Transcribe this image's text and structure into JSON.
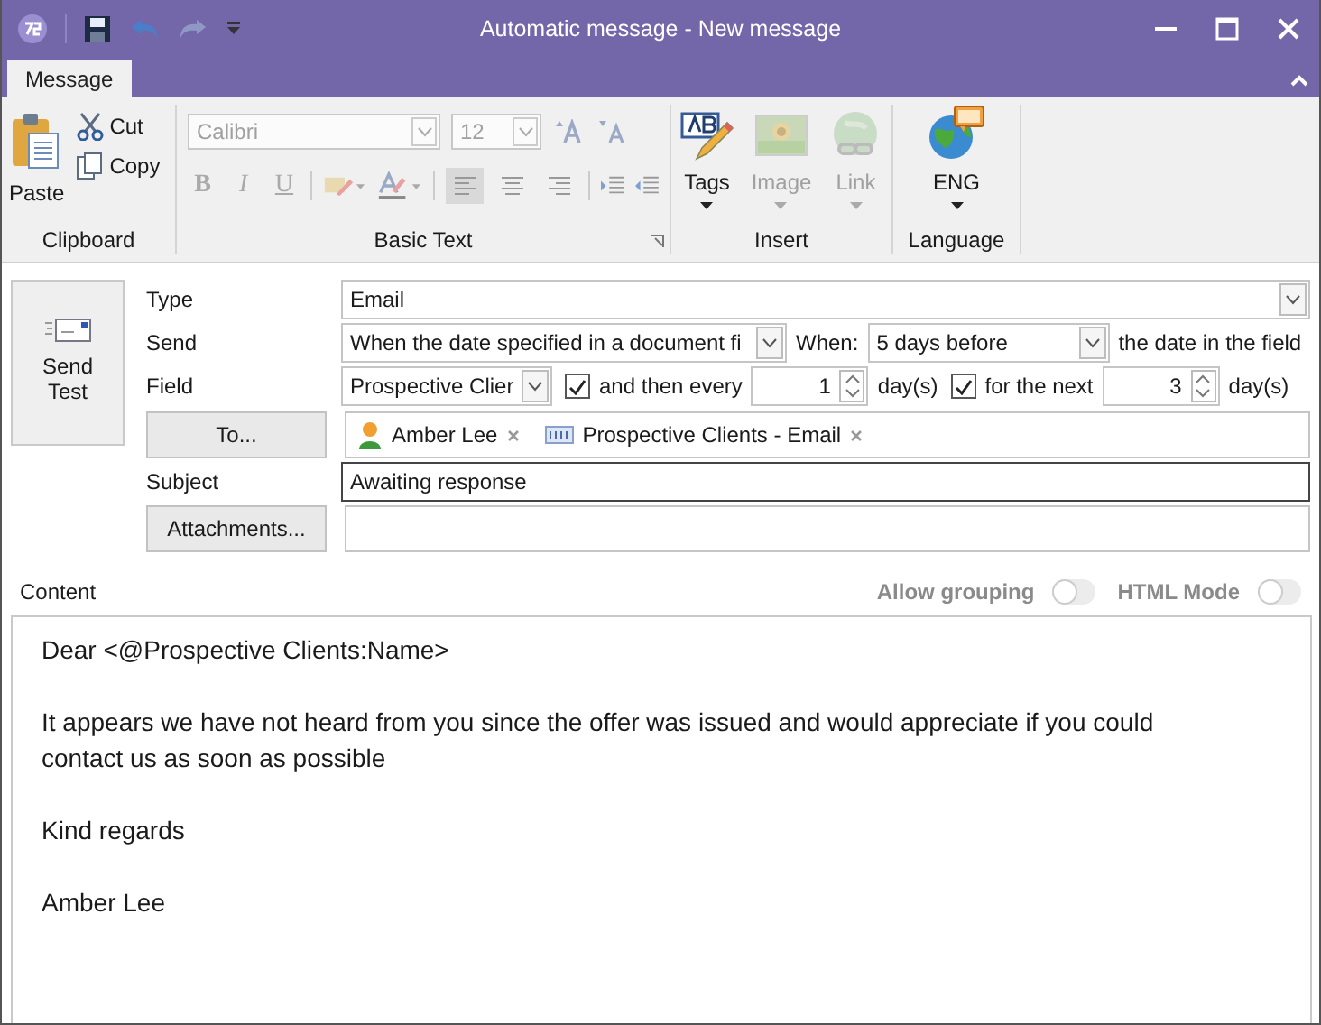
{
  "window": {
    "title": "Automatic message - New message"
  },
  "ribbon_tabs": [
    {
      "label": "Message",
      "selected": true
    }
  ],
  "clipboard": {
    "label": "Clipboard",
    "paste": "Paste",
    "cut": "Cut",
    "copy": "Copy"
  },
  "basic_text": {
    "label": "Basic Text",
    "font": "Calibri",
    "size": "12",
    "disabled": true,
    "format_buttons": [
      "B",
      "I",
      "U"
    ],
    "alignment": [
      {
        "selected": true
      },
      {
        "selected": false
      },
      {
        "selected": false
      }
    ]
  },
  "insert": {
    "label": "Insert",
    "items": [
      {
        "label": "Tags",
        "disabled": false,
        "kind": "tags"
      },
      {
        "label": "Image",
        "disabled": true,
        "kind": "image"
      },
      {
        "label": "Link",
        "disabled": true,
        "kind": "link"
      }
    ]
  },
  "language": {
    "label": "Language",
    "value": "ENG"
  },
  "send_test": "Send Test",
  "type": {
    "label": "Type",
    "value": "Email"
  },
  "send": {
    "label": "Send",
    "value": "When the date specified in a document fi",
    "when_label": "When:",
    "when_value": "5 days before",
    "suffix": "the date in the field"
  },
  "field": {
    "label": "Field",
    "value": "Prospective Clier",
    "then_every": {
      "label": "and then every",
      "checked": true
    },
    "every_value": "1",
    "every_unit": "day(s)",
    "for_next": {
      "label": "for the next",
      "checked": true
    },
    "next_value": "3",
    "next_unit": "day(s)"
  },
  "to": {
    "button": "To...",
    "recipients": [
      {
        "kind": "person",
        "name": "Amber Lee"
      },
      {
        "kind": "field",
        "name": "Prospective Clients - Email"
      }
    ]
  },
  "subject": {
    "label": "Subject",
    "value": "Awaiting response"
  },
  "attachments": {
    "button": "Attachments..."
  },
  "content": {
    "label": "Content",
    "toggles": [
      {
        "label": "Allow grouping",
        "on": false
      },
      {
        "label": "HTML Mode",
        "on": false
      }
    ],
    "paragraphs": [
      "Dear <@Prospective Clients:Name>",
      "It appears we have not heard from you since the offer was issued and would appreciate if you could contact us as soon as possible",
      "Kind regards",
      "Amber Lee"
    ]
  }
}
